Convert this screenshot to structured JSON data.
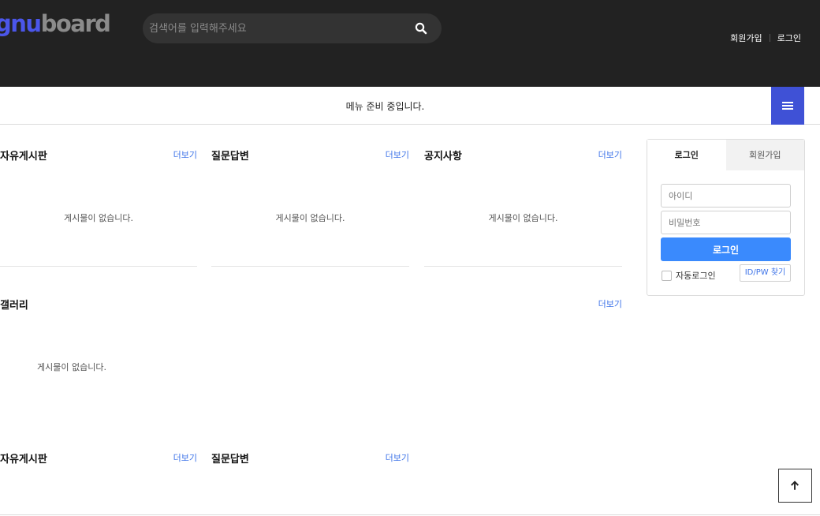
{
  "header": {
    "logo_part1": "gnu",
    "logo_part2": "board",
    "search_placeholder": "검색어를 입력해주세요",
    "join_link": "회원가입",
    "login_link": "로그인"
  },
  "nav": {
    "message": "메뉴 준비 중입니다."
  },
  "boards": [
    {
      "title": "자유게시판",
      "more": "더보기",
      "empty": "게시물이 없습니다."
    },
    {
      "title": "질문답변",
      "more": "더보기",
      "empty": "게시물이 없습니다."
    },
    {
      "title": "공지사항",
      "more": "더보기",
      "empty": "게시물이 없습니다."
    },
    {
      "title": "갤러리",
      "more": "더보기",
      "empty": "게시물이 없습니다."
    },
    {
      "title": "자유게시판",
      "more": "더보기"
    },
    {
      "title": "질문답변",
      "more": "더보기"
    }
  ],
  "login": {
    "tab_login": "로그인",
    "tab_join": "회원가입",
    "id_placeholder": "아이디",
    "pw_placeholder": "비밀번호",
    "submit": "로그인",
    "auto_login": "자동로그인",
    "find": "ID/PW 찾기"
  },
  "colors": {
    "header_bg": "#222222",
    "accent": "#3f51d6",
    "login_button": "#3a8afd",
    "link": "#3d73e8"
  }
}
